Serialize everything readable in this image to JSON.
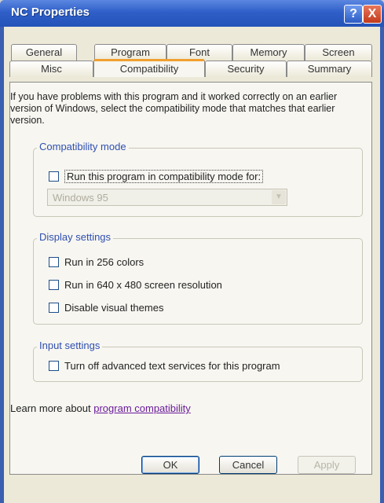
{
  "window": {
    "title": "NC Properties",
    "help_label": "?",
    "close_label": "X"
  },
  "tabs": {
    "row1": [
      "General",
      "Program",
      "Font",
      "Memory",
      "Screen"
    ],
    "row2": [
      "Misc",
      "Compatibility",
      "Security",
      "Summary"
    ],
    "active": "Compatibility"
  },
  "intro_text": "If you have problems with this program and it worked correctly on an earlier version of Windows, select the compatibility mode that matches that earlier version.",
  "compat_mode": {
    "label": "Compatibility mode",
    "checkbox_label": "Run this program in compatibility mode for:",
    "checked": false,
    "os_selected": "Windows 95",
    "os_disabled": true
  },
  "display": {
    "label": "Display settings",
    "options": [
      {
        "label": "Run in 256 colors",
        "checked": false
      },
      {
        "label": "Run in 640 x 480 screen resolution",
        "checked": false
      },
      {
        "label": "Disable visual themes",
        "checked": false
      }
    ]
  },
  "input": {
    "label": "Input settings",
    "options": [
      {
        "label": "Turn off advanced text services for this program",
        "checked": false
      }
    ]
  },
  "learn_more": {
    "prefix": "Learn more about",
    "link": "program compatibility"
  },
  "buttons": {
    "ok": "OK",
    "cancel": "Cancel",
    "apply": "Apply"
  }
}
